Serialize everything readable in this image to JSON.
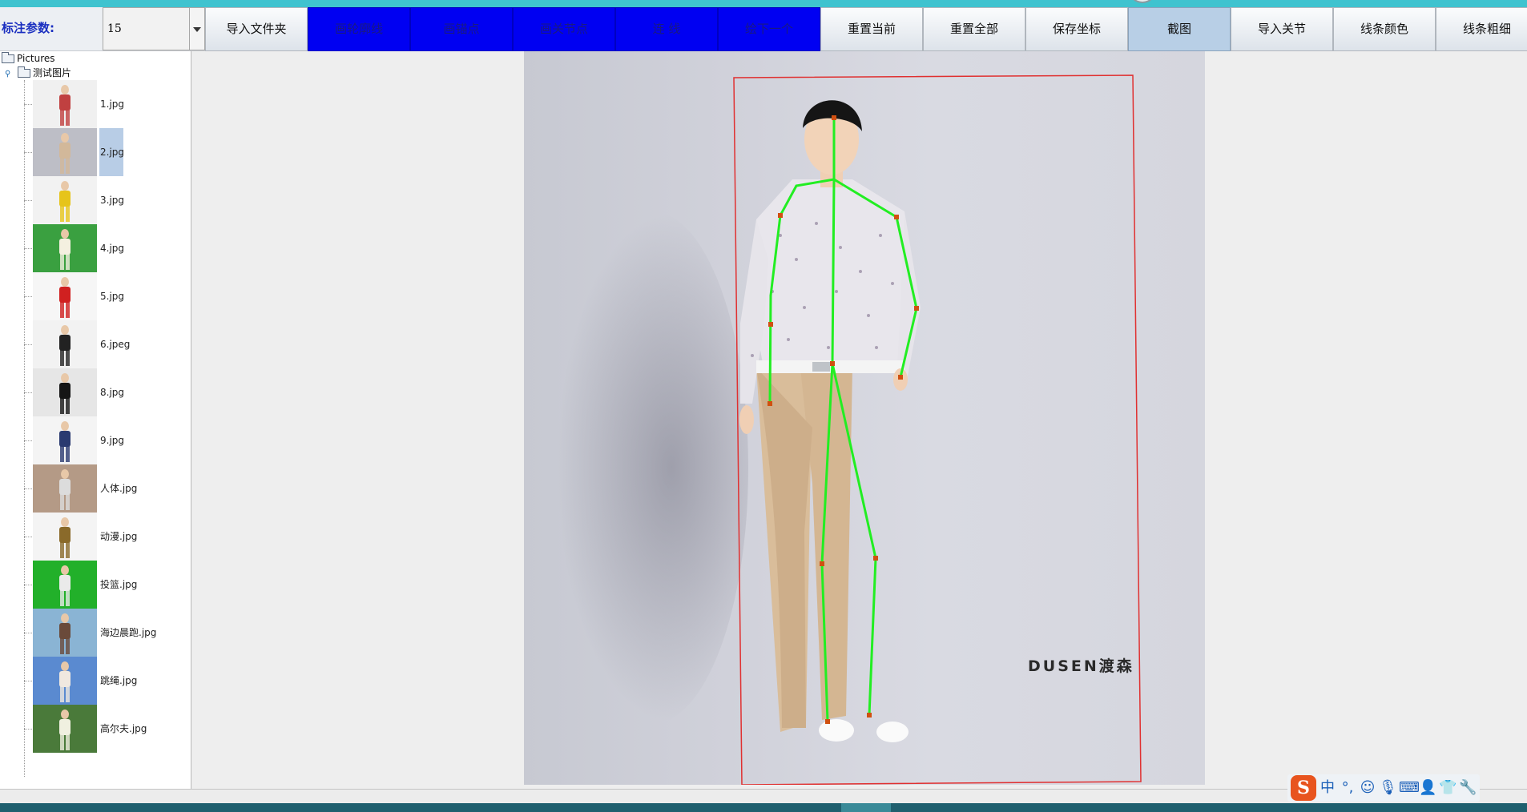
{
  "toolbar": {
    "param_label": "标注参数:",
    "param_value": "15",
    "buttons": [
      {
        "label": "导入文件夹",
        "style": "normal"
      },
      {
        "label": "画轮廓线",
        "style": "blue"
      },
      {
        "label": "画锚点",
        "style": "blue"
      },
      {
        "label": "画关节点",
        "style": "blue"
      },
      {
        "label": "连 线",
        "style": "blue"
      },
      {
        "label": "绘下一个",
        "style": "blue"
      },
      {
        "label": "重置当前",
        "style": "normal"
      },
      {
        "label": "重置全部",
        "style": "normal"
      },
      {
        "label": "保存坐标",
        "style": "normal"
      },
      {
        "label": "截图",
        "style": "active"
      },
      {
        "label": "导入关节",
        "style": "normal"
      },
      {
        "label": "线条颜色",
        "style": "normal"
      },
      {
        "label": "线条粗细",
        "style": "normal"
      }
    ]
  },
  "tree": {
    "root": "Pictures",
    "folder": "测试图片",
    "files": [
      {
        "name": "1.jpg",
        "bg": "#f0f0f0",
        "fig": "#c04040",
        "selected": false
      },
      {
        "name": "2.jpg",
        "bg": "#bdbec6",
        "fig": "#d2b89a",
        "selected": true
      },
      {
        "name": "3.jpg",
        "bg": "#f2f2f2",
        "fig": "#e6c41a",
        "selected": false
      },
      {
        "name": "4.jpg",
        "bg": "#3aa040",
        "fig": "#f4f0e0",
        "selected": false
      },
      {
        "name": "5.jpg",
        "bg": "#f6f6f6",
        "fig": "#d02020",
        "selected": false
      },
      {
        "name": "6.jpeg",
        "bg": "#f2f2f2",
        "fig": "#222222",
        "selected": false
      },
      {
        "name": "8.jpg",
        "bg": "#e6e6e6",
        "fig": "#151515",
        "selected": false
      },
      {
        "name": "9.jpg",
        "bg": "#f4f4f4",
        "fig": "#2a3a70",
        "selected": false
      },
      {
        "name": "人体.jpg",
        "bg": "#b49a86",
        "fig": "#dcdcdc",
        "selected": false
      },
      {
        "name": "动漫.jpg",
        "bg": "#f4f4f4",
        "fig": "#8a6a2a",
        "selected": false
      },
      {
        "name": "投篮.jpg",
        "bg": "#22b02a",
        "fig": "#eaeaea",
        "selected": false
      },
      {
        "name": "海边晨跑.jpg",
        "bg": "#8ab4d4",
        "fig": "#6a4a3a",
        "selected": false
      },
      {
        "name": "跳绳.jpg",
        "bg": "#5a8ad0",
        "fig": "#f0e8e0",
        "selected": false
      },
      {
        "name": "高尔夫.jpg",
        "bg": "#4a7a3a",
        "fig": "#f0f0e0",
        "selected": false
      }
    ]
  },
  "canvas": {
    "brand_text": "DUSEN渡森",
    "bbox_color": "#e03030",
    "skeleton_color": "#22ee22",
    "joint_color": "#d05010"
  },
  "ime": {
    "logo": "S",
    "items": [
      {
        "icon": "chinese-mode-icon",
        "glyph": "中"
      },
      {
        "icon": "punctuation-icon",
        "glyph": "°,"
      },
      {
        "icon": "emoji-icon",
        "glyph": "☺"
      },
      {
        "icon": "microphone-icon",
        "glyph": "🎙"
      },
      {
        "icon": "keyboard-icon",
        "glyph": "⌨"
      },
      {
        "icon": "user-icon",
        "glyph": "👤"
      },
      {
        "icon": "shirt-icon",
        "glyph": "👕"
      },
      {
        "icon": "wrench-icon",
        "glyph": "🔧"
      }
    ]
  }
}
